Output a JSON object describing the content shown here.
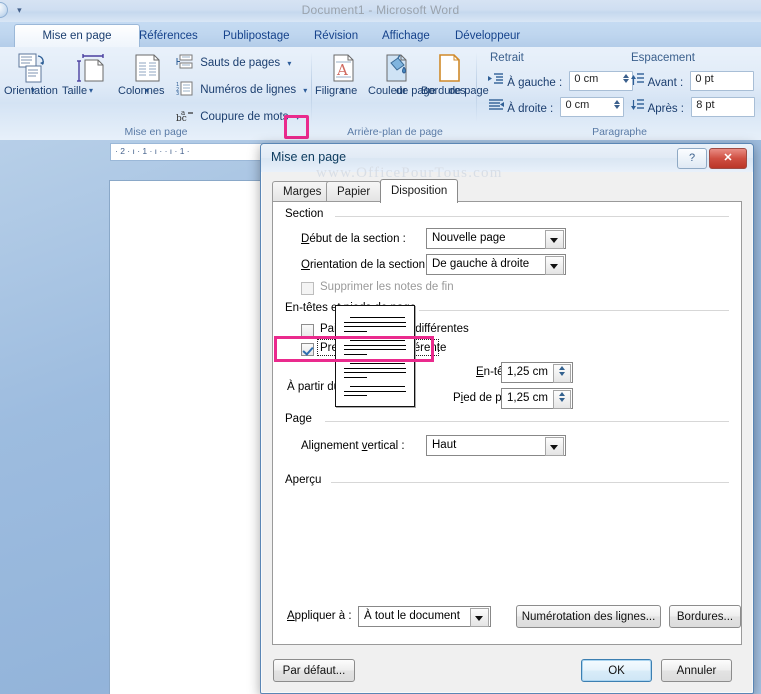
{
  "app": {
    "title": "Document1 - Microsoft Word",
    "quick_access_caret": "▾"
  },
  "ribbon": {
    "tabs": [
      {
        "label": "Mise en page",
        "active": true
      },
      {
        "label": "Références",
        "active": false
      },
      {
        "label": "Publipostage",
        "active": false
      },
      {
        "label": "Révision",
        "active": false
      },
      {
        "label": "Affichage",
        "active": false
      },
      {
        "label": "Développeur",
        "active": false
      }
    ],
    "groups": {
      "page_setup": {
        "label": "Mise en page",
        "big_buttons": [
          {
            "label": "Orientation",
            "icon": "orientation-icon",
            "caret": "▾"
          },
          {
            "label": "Taille",
            "icon": "size-icon",
            "caret": "▾"
          },
          {
            "label": "Colonnes",
            "icon": "columns-icon",
            "caret": "▾"
          }
        ],
        "small_buttons": [
          {
            "label": "Sauts de pages",
            "icon": "page-breaks-icon",
            "caret": "▾"
          },
          {
            "label": "Numéros de lignes",
            "icon": "line-numbers-icon",
            "caret": "▾"
          },
          {
            "label": "Coupure de mots",
            "icon": "hyphenation-icon",
            "caret": "▾"
          }
        ],
        "launcher_highlighted": true
      },
      "page_background": {
        "label": "Arrière-plan de page",
        "big_buttons": [
          {
            "label": "Filigrane",
            "label2": "",
            "icon": "watermark-icon",
            "caret": "▾"
          },
          {
            "label": "Couleur",
            "label2": "de page",
            "icon": "page-color-icon",
            "caret": "▾"
          },
          {
            "label": "Bordures",
            "label2": "de page",
            "icon": "page-borders-icon",
            "caret": ""
          }
        ]
      },
      "paragraph": {
        "label": "Paragraphe",
        "indent_title": "Retrait",
        "spacing_title": "Espacement",
        "fields": [
          {
            "label": "À gauche :",
            "value": "0 cm",
            "icon": "indent-left-icon"
          },
          {
            "label": "À droite :",
            "value": "0 cm",
            "icon": "indent-right-icon"
          },
          {
            "label": "Avant :",
            "value": "0  pt",
            "icon": "space-before-icon"
          },
          {
            "label": "Après :",
            "value": "8  pt",
            "icon": "space-after-icon"
          }
        ]
      }
    }
  },
  "ruler": {
    "ticks": "·  2  ·  ı  ·  1  ·  ı  ·        ·  ı  ·  1  ·"
  },
  "dialog": {
    "title": "Mise en page",
    "help_button": "?",
    "close_button": "✕",
    "watermark": "www.OfficePourTous.com",
    "tabs": [
      {
        "label": "Marges",
        "active": false
      },
      {
        "label": "Papier",
        "active": false
      },
      {
        "label": "Disposition",
        "active": true
      }
    ],
    "section": {
      "legend": "Section",
      "start_label": "Début de la section :",
      "start_value": "Nouvelle page",
      "orientation_label": "Orientation de la section :",
      "orientation_value": "De gauche à droite",
      "suppress_endnotes_label": "Supprimer les notes de fin",
      "suppress_endnotes_checked": false,
      "suppress_endnotes_disabled": true
    },
    "headers_footers": {
      "legend": "En-têtes et pieds de page",
      "odd_even_label": "Paires et impaires différentes",
      "odd_even_checked": false,
      "first_page_label": "Première page différente",
      "first_page_checked": true,
      "first_page_highlighted": true,
      "from_edge_label": "À partir du bord :",
      "header_label": "En-tête :",
      "header_value": "1,25 cm",
      "footer_label": "Pied de page :",
      "footer_value": "1,25 cm"
    },
    "page": {
      "legend": "Page",
      "valign_label": "Alignement vertical :",
      "valign_value": "Haut"
    },
    "preview": {
      "legend": "Aperçu",
      "apply_to_label": "Appliquer à :",
      "apply_to_value": "À tout le document",
      "line_numbers_button": "Numérotation des lignes...",
      "borders_button": "Bordures..."
    },
    "footer_buttons": {
      "default": "Par défaut...",
      "ok": "OK",
      "cancel": "Annuler"
    }
  },
  "colors": {
    "highlight_pink": "#ea2a8d",
    "dialog_accent": "#5a86b5",
    "ribbon_text": "#1b3e6f"
  }
}
